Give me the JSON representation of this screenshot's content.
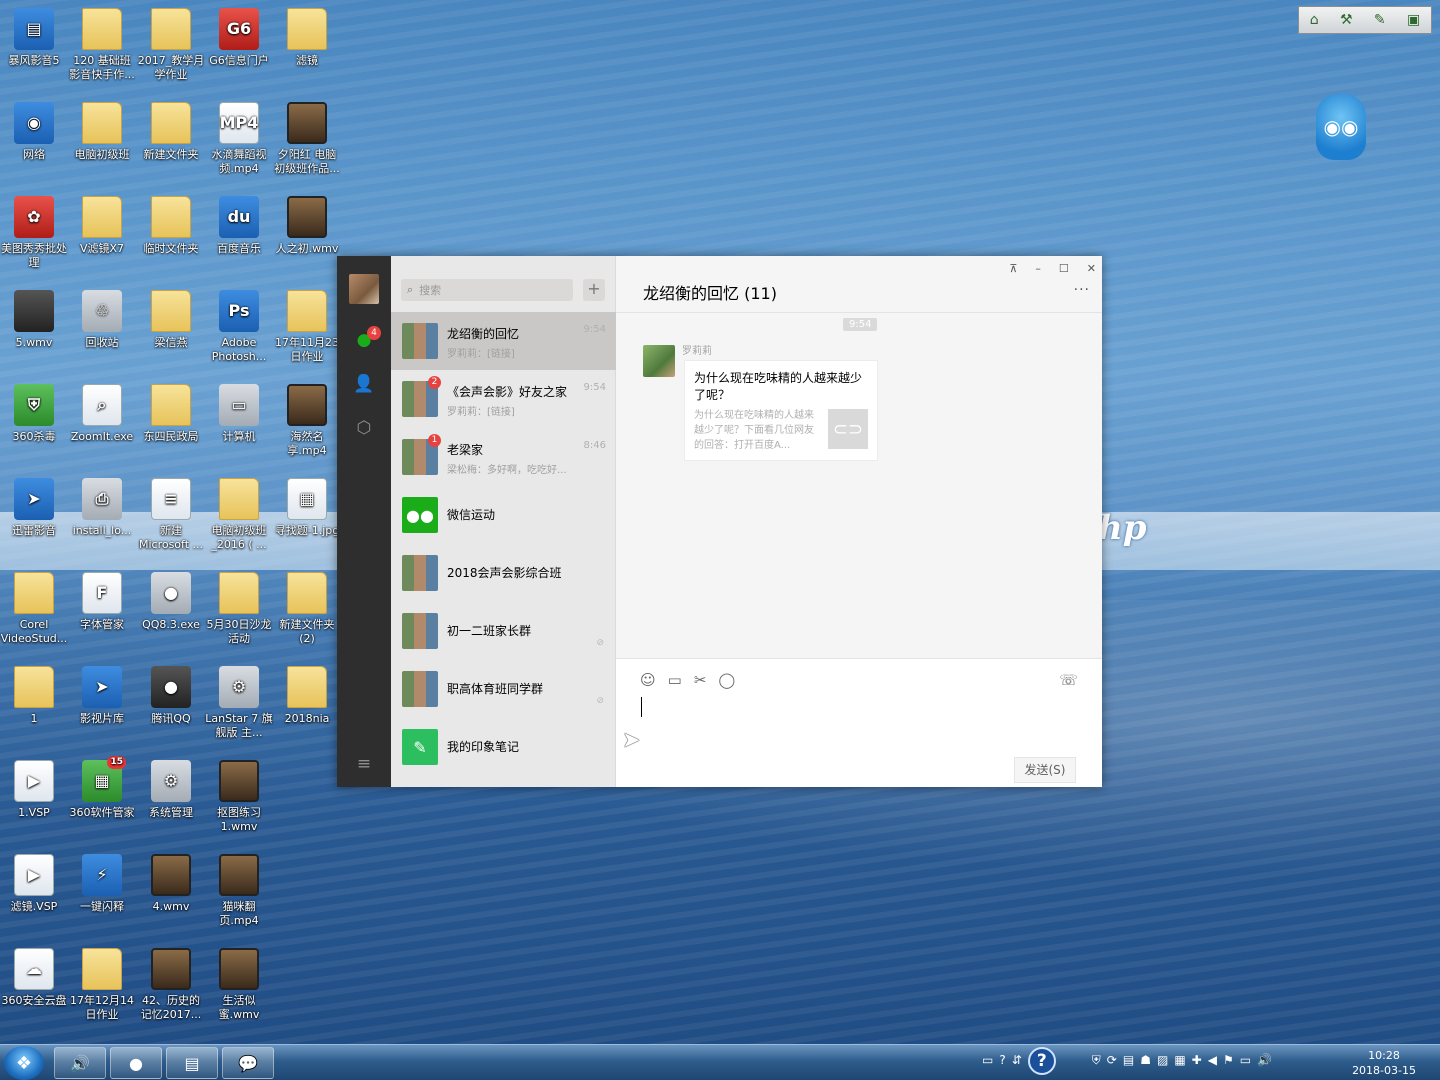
{
  "desktop": {
    "icons": [
      {
        "label": "暴风影音5",
        "kind": "blue",
        "glyph": "▤"
      },
      {
        "label": "120 基础班影音快手作...",
        "kind": "folder",
        "glyph": ""
      },
      {
        "label": "2017_教学月学作业",
        "kind": "folder",
        "glyph": ""
      },
      {
        "label": "G6信息门户",
        "kind": "red",
        "glyph": "G6"
      },
      {
        "label": "滤镜",
        "kind": "folder",
        "glyph": ""
      },
      {
        "label": "网络",
        "kind": "blue",
        "glyph": "◉"
      },
      {
        "label": "电脑初级班",
        "kind": "folder",
        "glyph": ""
      },
      {
        "label": "新建文件夹",
        "kind": "folder",
        "glyph": ""
      },
      {
        "label": "水滴舞蹈视频.mp4",
        "kind": "white",
        "glyph": "MP4"
      },
      {
        "label": "夕阳红 电脑初级班作品...",
        "kind": "film",
        "glyph": ""
      },
      {
        "label": "美图秀秀批处理",
        "kind": "red",
        "glyph": "✿"
      },
      {
        "label": "V滤镜X7",
        "kind": "folder",
        "glyph": ""
      },
      {
        "label": "临时文件夹",
        "kind": "folder",
        "glyph": ""
      },
      {
        "label": "百度音乐",
        "kind": "blue",
        "glyph": "du"
      },
      {
        "label": "人之初.wmv",
        "kind": "film",
        "glyph": ""
      },
      {
        "label": "5.wmv",
        "kind": "dark",
        "glyph": ""
      },
      {
        "label": "回收站",
        "kind": "gray",
        "glyph": "♲"
      },
      {
        "label": "梁信燕",
        "kind": "folder",
        "glyph": ""
      },
      {
        "label": "Adobe Photosh...",
        "kind": "blue",
        "glyph": "Ps"
      },
      {
        "label": "17年11月23日作业",
        "kind": "folder",
        "glyph": ""
      },
      {
        "label": "360杀毒",
        "kind": "green",
        "glyph": "⛨"
      },
      {
        "label": "ZoomIt.exe",
        "kind": "white",
        "glyph": "⌕"
      },
      {
        "label": "东四民政局",
        "kind": "folder",
        "glyph": ""
      },
      {
        "label": "计算机",
        "kind": "gray",
        "glyph": "▭"
      },
      {
        "label": "海然名享.mp4",
        "kind": "film",
        "glyph": ""
      },
      {
        "label": "迅雷影音",
        "kind": "blue",
        "glyph": "➤"
      },
      {
        "label": "install_lo...",
        "kind": "gray",
        "glyph": "⎙"
      },
      {
        "label": "新建 Microsoft ...",
        "kind": "white",
        "glyph": "≡"
      },
      {
        "label": "电脑初级班 _2016 ( ...",
        "kind": "folder",
        "glyph": ""
      },
      {
        "label": "寻找题-1.jpg",
        "kind": "white",
        "glyph": "▦"
      },
      {
        "label": "Corel VideoStud...",
        "kind": "folder",
        "glyph": ""
      },
      {
        "label": "字体管家",
        "kind": "white",
        "glyph": "F"
      },
      {
        "label": "QQ8.3.exe",
        "kind": "gray",
        "glyph": "●"
      },
      {
        "label": "5月30日沙龙活动",
        "kind": "folder",
        "glyph": ""
      },
      {
        "label": "新建文件夹 (2)",
        "kind": "folder",
        "glyph": ""
      },
      {
        "label": "1",
        "kind": "folder",
        "glyph": ""
      },
      {
        "label": "影视片库",
        "kind": "blue",
        "glyph": "➤"
      },
      {
        "label": "腾讯QQ",
        "kind": "dark",
        "glyph": "●"
      },
      {
        "label": "LanStar 7 旗舰版 主...",
        "kind": "gray",
        "glyph": "⚙"
      },
      {
        "label": "2018nia",
        "kind": "folder",
        "glyph": ""
      },
      {
        "label": "1.VSP",
        "kind": "white",
        "glyph": "▶"
      },
      {
        "label": "360软件管家",
        "kind": "green",
        "glyph": "▦",
        "badge": "15"
      },
      {
        "label": "系统管理",
        "kind": "gray",
        "glyph": "⚙"
      },
      {
        "label": "抠图练习1.wmv",
        "kind": "film",
        "glyph": ""
      },
      {
        "label": "",
        "kind": "none",
        "glyph": ""
      },
      {
        "label": "滤镜.VSP",
        "kind": "white",
        "glyph": "▶"
      },
      {
        "label": "一键闪释",
        "kind": "blue",
        "glyph": "⚡"
      },
      {
        "label": "4.wmv",
        "kind": "film",
        "glyph": ""
      },
      {
        "label": "猫咪翻页.mp4",
        "kind": "film",
        "glyph": ""
      },
      {
        "label": "",
        "kind": "none",
        "glyph": ""
      },
      {
        "label": "360安全云盘",
        "kind": "white",
        "glyph": "☁"
      },
      {
        "label": "17年12月14日作业",
        "kind": "folder",
        "glyph": ""
      },
      {
        "label": "42、历史的记忆2017...",
        "kind": "film",
        "glyph": ""
      },
      {
        "label": "生活似蜜.wmv",
        "kind": "film",
        "glyph": ""
      }
    ]
  },
  "quick_toolbar": {
    "icons": [
      "home-icon",
      "tools-icon",
      "pencil-icon",
      "screen-icon"
    ],
    "glyphs": [
      "⌂",
      "⚒",
      "✎",
      "▣"
    ]
  },
  "wechat": {
    "nav": {
      "chat_badge": "4",
      "glyphs": {
        "chat": "●",
        "contacts": "👤",
        "favorites": "⬡",
        "menu": "≡"
      }
    },
    "search_placeholder": "搜索",
    "add_glyph": "+",
    "conversations": [
      {
        "name": "龙绍衡的回忆",
        "time": "9:54",
        "preview": "罗莉莉：[链接]",
        "badge": "",
        "avatar": "grid",
        "selected": true
      },
      {
        "name": "《会声会影》好友之家",
        "time": "9:54",
        "preview": "罗莉莉：[链接]",
        "badge": "2",
        "avatar": "grid",
        "selected": false
      },
      {
        "name": "老梁家",
        "time": "8:46",
        "preview": "梁松梅：多好啊，吃吃好...",
        "badge": "1",
        "avatar": "grid",
        "selected": false
      },
      {
        "name": "微信运动",
        "time": "",
        "preview": "",
        "badge": "",
        "avatar": "greenapp",
        "selected": false
      },
      {
        "name": "2018会声会影综合班",
        "time": "",
        "preview": "",
        "badge": "",
        "avatar": "grid",
        "selected": false
      },
      {
        "name": "初一二班家长群",
        "time": "",
        "preview": "",
        "badge": "",
        "avatar": "grid",
        "selected": false,
        "muted": true
      },
      {
        "name": "职高体育班同学群",
        "time": "",
        "preview": "",
        "badge": "",
        "avatar": "grid",
        "selected": false,
        "muted": true
      },
      {
        "name": "我的印象笔记",
        "time": "",
        "preview": "",
        "badge": "",
        "avatar": "evernote",
        "selected": false
      }
    ],
    "chat": {
      "title": "龙绍衡的回忆 (11)",
      "more_glyph": "···",
      "window_controls": [
        "⊼",
        "–",
        "☐",
        "✕"
      ],
      "timestamp": "9:54",
      "sender": "罗莉莉",
      "card_title": "为什么现在吃味精的人越来越少了呢？",
      "card_desc": "为什么现在吃味精的人越来越少了呢？下面看几位网友的回答：打开百度A...",
      "card_link_glyph": "⊂⊃",
      "toolbar_glyphs": [
        "☺",
        "▭",
        "✂",
        "◯"
      ],
      "call_glyph": "☏",
      "send_label": "发送(S)"
    }
  },
  "taskbar": {
    "start_glyph": "❖",
    "buttons": [
      "🔊",
      "●",
      "▤",
      "💬"
    ],
    "tray_glyphs": [
      "▭",
      "?",
      "⇵",
      "⛨",
      "⟳",
      "▤",
      "☗",
      "▨",
      "▦",
      "✚",
      "◀",
      "⚑",
      "▭",
      "🔊"
    ],
    "help_glyph": "?",
    "time": "10:28",
    "date": "2018-03-15"
  }
}
